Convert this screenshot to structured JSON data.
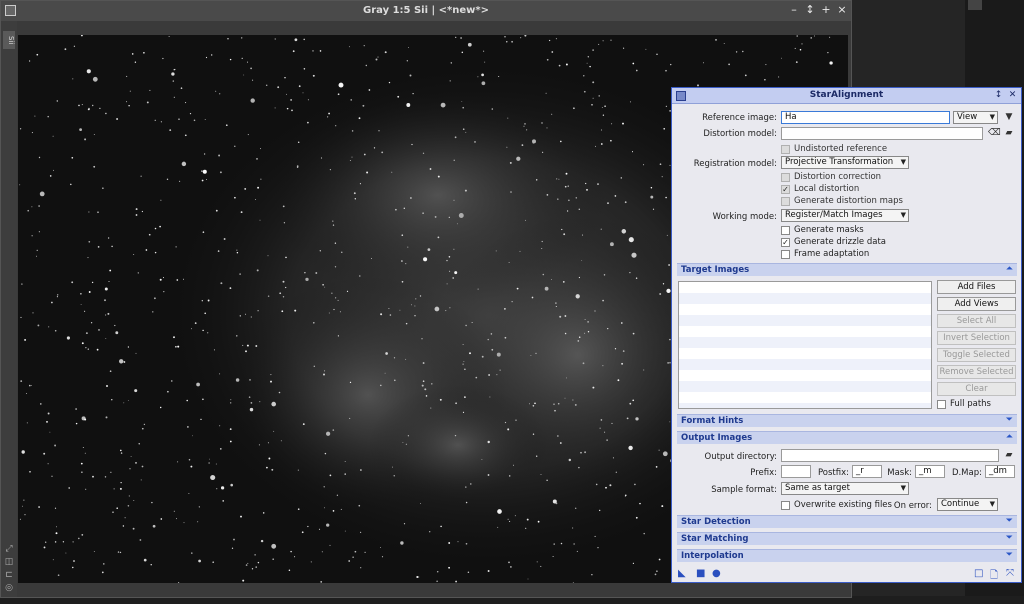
{
  "image_window": {
    "title": "Gray 1:5 Sii | <*new*>",
    "side_tab": "Sii",
    "controls": [
      "–",
      "↕",
      "+",
      "×"
    ]
  },
  "dialog": {
    "title": "StarAlignment",
    "controls": [
      "↕",
      "✕"
    ],
    "reference_image_label": "Reference image:",
    "reference_image_value": "Ha",
    "reference_view_combo": "View",
    "distortion_model_label": "Distortion model:",
    "distortion_model_value": "",
    "undistorted_reference": "Undistorted reference",
    "registration_model_label": "Registration model:",
    "registration_model_value": "Projective Transformation",
    "distortion_correction": "Distortion correction",
    "local_distortion": "Local distortion",
    "generate_distortion_maps": "Generate distortion maps",
    "working_mode_label": "Working mode:",
    "working_mode_value": "Register/Match Images",
    "generate_masks": "Generate masks",
    "generate_drizzle_data": "Generate drizzle data",
    "frame_adaptation": "Frame adaptation",
    "sections": {
      "target_images": "Target Images",
      "format_hints": "Format Hints",
      "output_images": "Output Images",
      "star_detection": "Star Detection",
      "star_matching": "Star Matching",
      "interpolation": "Interpolation"
    },
    "buttons": {
      "add_files": "Add Files",
      "add_views": "Add Views",
      "select_all": "Select All",
      "invert_selection": "Invert Selection",
      "toggle_selected": "Toggle Selected",
      "remove_selected": "Remove Selected",
      "clear": "Clear"
    },
    "full_paths": "Full paths",
    "output_directory_label": "Output directory:",
    "output_directory_value": "",
    "prefix_label": "Prefix:",
    "prefix_value": "",
    "postfix_label": "Postfix:",
    "postfix_value": "_r",
    "mask_label": "Mask:",
    "mask_value": "_m",
    "dmap_label": "D.Map:",
    "dmap_value": "_dm",
    "sample_format_label": "Sample format:",
    "sample_format_value": "Same as target",
    "overwrite_existing_files": "Overwrite existing files",
    "on_error_label": "On error:",
    "on_error_value": "Continue"
  },
  "colors": {
    "dialog_border": "#3a5cc7",
    "section_header": "#c9d2ee",
    "section_text": "#1f3a8f"
  },
  "icons": {
    "new_instance": "triangle-icon",
    "apply_global": "square-icon",
    "apply": "circle-icon",
    "description": "square-outline-icon",
    "documentation": "document-icon",
    "reset": "reset-icon"
  }
}
